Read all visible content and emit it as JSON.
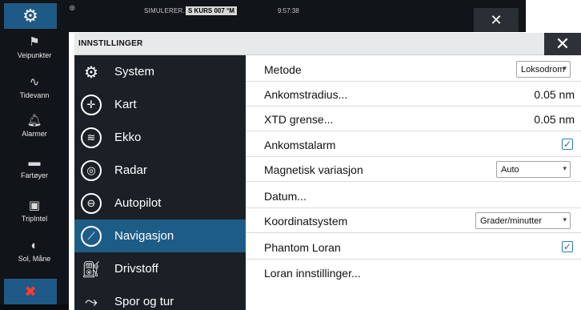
{
  "topbar": {
    "home_icon": "gear-icon",
    "globe_icon": "globe-icon",
    "sim_label": "SIMULERER...",
    "kurs_badge": "S KURS 007 °M",
    "time": "9:57:38",
    "close_symbol": "✕"
  },
  "sidebar": {
    "items": [
      {
        "icon": "flag-icon",
        "label": "Veipunkter"
      },
      {
        "icon": "tide-wave-icon",
        "label": "Tidevann"
      },
      {
        "icon": "bell-icon",
        "label": "Alarmer"
      },
      {
        "icon": "vessel-icon",
        "label": "Fartøyer"
      },
      {
        "icon": "tripintel-icon",
        "label": "TripIntel"
      },
      {
        "icon": "sun-moon-icon",
        "label": "Sol, Måne"
      }
    ],
    "bottom_icon": "tools-icon"
  },
  "dialog": {
    "title": "INNSTILLINGER",
    "close_symbol": "✕",
    "menu": [
      {
        "icon": "gear-icon",
        "label": "System",
        "active": false
      },
      {
        "icon": "chart-compass-icon",
        "label": "Kart",
        "active": false
      },
      {
        "icon": "sonar-icon",
        "label": "Ekko",
        "active": false
      },
      {
        "icon": "radar-icon",
        "label": "Radar",
        "active": false
      },
      {
        "icon": "steering-wheel-icon",
        "label": "Autopilot",
        "active": false
      },
      {
        "icon": "navigation-compass-icon",
        "label": "Navigasjon",
        "active": true
      },
      {
        "icon": "fuel-pump-icon",
        "label": "Drivstoff",
        "active": false
      },
      {
        "icon": "track-icon",
        "label": "Spor og tur",
        "active": false
      }
    ],
    "settings": {
      "metode": {
        "label": "Metode",
        "value": "Loksodrom"
      },
      "ankomstradius": {
        "label": "Ankomstradius...",
        "value": "0.05 nm"
      },
      "xtd": {
        "label": "XTD grense...",
        "value": "0.05 nm"
      },
      "ankomstalarm": {
        "label": "Ankomstalarm",
        "checked": true
      },
      "magnetisk": {
        "label": "Magnetisk variasjon",
        "value": "Auto"
      },
      "datum": {
        "label": "Datum..."
      },
      "koordinat": {
        "label": "Koordinatsystem",
        "value": "Grader/minutter"
      },
      "phantom": {
        "label": "Phantom Loran",
        "checked": true
      },
      "loran": {
        "label": "Loran innstillinger..."
      }
    }
  },
  "colors": {
    "accent": "#1e5c88",
    "menu_bg": "#1b2026",
    "bar_bg": "#111418"
  }
}
